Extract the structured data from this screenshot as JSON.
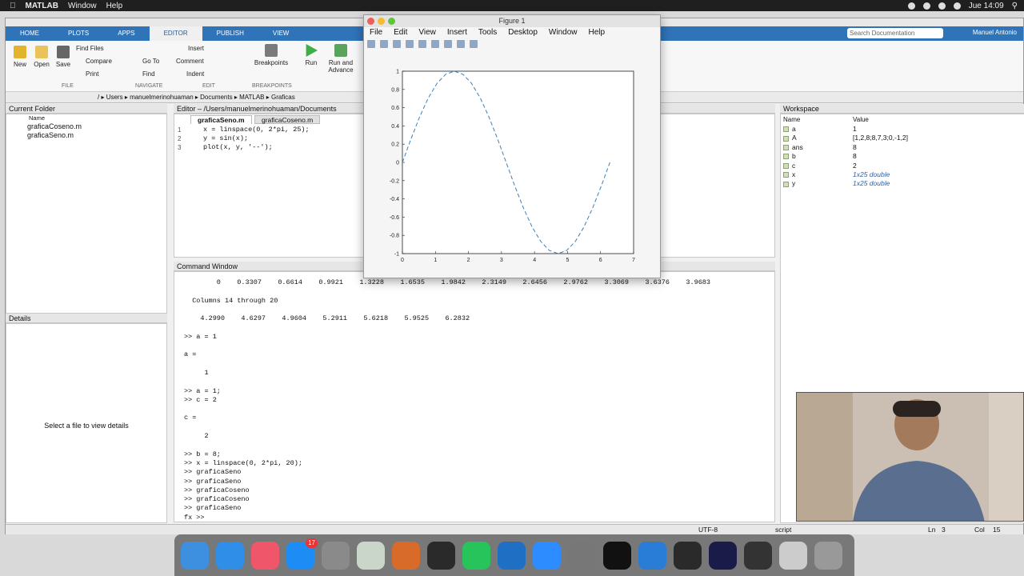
{
  "mac_menubar": {
    "app": "MATLAB",
    "menus": [
      "Window",
      "Help"
    ],
    "clock": "Jue 14:09",
    "search_icon": "search-icon"
  },
  "ribbon_tabs": [
    "HOME",
    "PLOTS",
    "APPS",
    "EDITOR",
    "PUBLISH",
    "VIEW"
  ],
  "active_tab": "EDITOR",
  "search": {
    "placeholder": "Search Documentation"
  },
  "user": "Manuel Antonio",
  "ribbon": {
    "new": "New",
    "open": "Open",
    "save": "Save",
    "find_files": "Find Files",
    "compare": "Compare",
    "print": "Print",
    "go_to": "Go To",
    "find": "Find",
    "insert": "Insert",
    "comment": "Comment",
    "indent": "Indent",
    "breakpoints": "Breakpoints",
    "run": "Run",
    "run_advance": "Run and Advance",
    "sections": [
      "FILE",
      "NAVIGATE",
      "EDIT",
      "BREAKPOINTS"
    ]
  },
  "address": [
    "/",
    "Users",
    "manuelmerinohuaman",
    "Documents",
    "MATLAB",
    "Graficas"
  ],
  "current_folder": {
    "title": "Current Folder",
    "col": "Name",
    "files": [
      "graficaCoseno.m",
      "graficaSeno.m"
    ]
  },
  "details": {
    "title": "Details",
    "empty": "Select a file to view details"
  },
  "editor": {
    "title": "Editor – /Users/manuelmerinohuaman/Documents",
    "tabs": [
      "graficaSeno.m",
      "graficaCoseno.m"
    ],
    "lines": [
      "x = linspace(0, 2*pi, 25);",
      "y = sin(x);",
      "plot(x, y, '--');"
    ]
  },
  "command_window": {
    "title": "Command Window",
    "lines": [
      "        0    0.3307    0.6614    0.9921    1.3228    1.6535    1.9842    2.3149    2.6456    2.9762    3.3069    3.6376    3.9683",
      "",
      "  Columns 14 through 20",
      "",
      "    4.2990    4.6297    4.9604    5.2911    5.6218    5.9525    6.2832",
      "",
      ">> a = 1",
      "",
      "a =",
      "",
      "     1",
      "",
      ">> a = 1;",
      ">> c = 2",
      "",
      "c =",
      "",
      "     2",
      "",
      ">> b = 8;",
      ">> x = linspace(0, 2*pi, 20);",
      ">> graficaSeno",
      ">> graficaSeno",
      ">> graficaCoseno",
      ">> graficaCoseno",
      ">> graficaSeno"
    ],
    "prompt": "fx >>"
  },
  "workspace": {
    "title": "Workspace",
    "col_name": "Name",
    "col_value": "Value",
    "vars": [
      {
        "name": "a",
        "value": "1"
      },
      {
        "name": "A",
        "value": "[1,2,8;8,7,3;0,-1,2]"
      },
      {
        "name": "ans",
        "value": "8"
      },
      {
        "name": "b",
        "value": "8"
      },
      {
        "name": "c",
        "value": "2"
      },
      {
        "name": "x",
        "value": "1x25 double"
      },
      {
        "name": "y",
        "value": "1x25 double"
      }
    ]
  },
  "status": {
    "encoding": "UTF-8",
    "type": "script",
    "ln_label": "Ln",
    "ln": "3",
    "col_label": "Col",
    "col": "15"
  },
  "figure": {
    "title": "Figure 1",
    "menus": [
      "File",
      "Edit",
      "View",
      "Insert",
      "Tools",
      "Desktop",
      "Window",
      "Help"
    ]
  },
  "chart_data": {
    "type": "line",
    "x_range": [
      0,
      7
    ],
    "y_range": [
      -1,
      1
    ],
    "xticks": [
      0,
      1,
      2,
      3,
      4,
      5,
      6,
      7
    ],
    "yticks": [
      -1,
      -0.8,
      -0.6,
      -0.4,
      -0.2,
      0,
      0.2,
      0.4,
      0.6,
      0.8,
      1
    ],
    "line_style": "dashed",
    "color": "#3f7fb5",
    "series": [
      {
        "function": "sin",
        "x_start": 0,
        "x_end": 6.2832,
        "points": 25
      }
    ]
  },
  "dock_icons": [
    "finder-icon",
    "safari-icon",
    "music-icon",
    "app-store-icon",
    "settings-icon",
    "keyboard-icon",
    "matlab-icon",
    "inkscape-icon",
    "whatsapp-icon",
    "r-icon",
    "zoom-icon",
    "tex-icon",
    "terminal-icon",
    "edge-icon",
    "acrobat-icon",
    "audition-icon",
    "window-icon",
    "window-icon",
    "trash-icon"
  ],
  "dock_badge": "17"
}
